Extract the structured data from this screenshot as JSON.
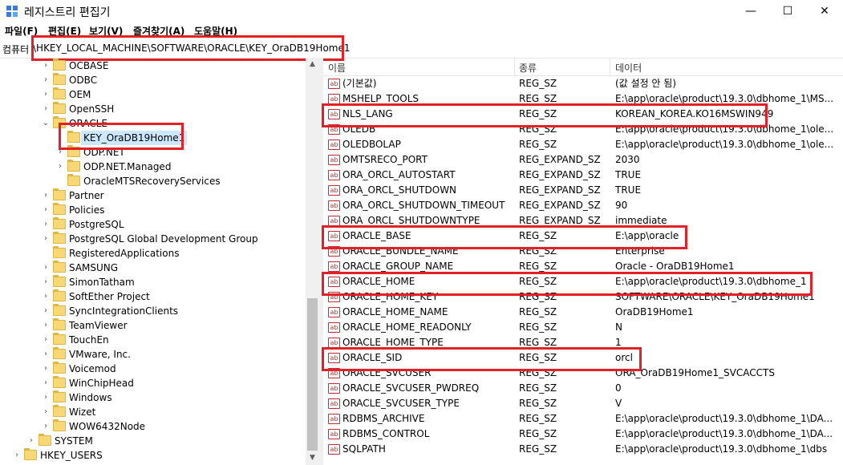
{
  "window": {
    "title": "레지스트리 편집기",
    "minimize_glyph": "—",
    "maximize_glyph": "☐",
    "close_glyph": "✕"
  },
  "menu": [
    "파일(F)",
    "편집(E)",
    "보기(V)",
    "즐겨찾기(A)",
    "도움말(H)"
  ],
  "address": {
    "label": "컴퓨터",
    "path": "\\HKEY_LOCAL_MACHINE\\SOFTWARE\\ORACLE\\KEY_OraDB19Home1"
  },
  "tree": [
    {
      "label": "OCBASE",
      "expander": "›"
    },
    {
      "label": "ODBC",
      "expander": "›"
    },
    {
      "label": "OEM",
      "expander": "›"
    },
    {
      "label": "OpenSSH",
      "expander": "›"
    },
    {
      "label": "ORACLE",
      "expander": "⌄"
    },
    {
      "label": "KEY_OraDB19Home1",
      "expander": ""
    },
    {
      "label": "ODP.NET",
      "expander": "›"
    },
    {
      "label": "ODP.NET.Managed",
      "expander": "›"
    },
    {
      "label": "OracleMTSRecoveryServices",
      "expander": ""
    },
    {
      "label": "Partner",
      "expander": "›"
    },
    {
      "label": "Policies",
      "expander": "›"
    },
    {
      "label": "PostgreSQL",
      "expander": "›"
    },
    {
      "label": "PostgreSQL Global Development Group",
      "expander": "›"
    },
    {
      "label": "RegisteredApplications",
      "expander": ""
    },
    {
      "label": "SAMSUNG",
      "expander": "›"
    },
    {
      "label": "SimonTatham",
      "expander": "›"
    },
    {
      "label": "SoftEther Project",
      "expander": "›"
    },
    {
      "label": "SyncIntegrationClients",
      "expander": "›"
    },
    {
      "label": "TeamViewer",
      "expander": "›"
    },
    {
      "label": "TouchEn",
      "expander": "›"
    },
    {
      "label": "VMware, Inc.",
      "expander": "›"
    },
    {
      "label": "Voicemod",
      "expander": "›"
    },
    {
      "label": "WinChipHead",
      "expander": "›"
    },
    {
      "label": "Windows",
      "expander": "›"
    },
    {
      "label": "Wizet",
      "expander": "›"
    },
    {
      "label": "WOW6432Node",
      "expander": "›"
    },
    {
      "label": "SYSTEM",
      "expander": "›"
    },
    {
      "label": "HKEY_USERS",
      "expander": "›"
    }
  ],
  "columns": {
    "name": "이름",
    "type": "종류",
    "data": "데이터"
  },
  "values": [
    {
      "name": "(기본값)",
      "type": "REG_SZ",
      "data": "(값 설정 안 됨)"
    },
    {
      "name": "MSHELP_TOOLS",
      "type": "REG_SZ",
      "data": "E:\\app\\oracle\\product\\19.3.0\\dbhome_1\\MS..."
    },
    {
      "name": "NLS_LANG",
      "type": "REG_SZ",
      "data": "KOREAN_KOREA.KO16MSWIN949"
    },
    {
      "name": "OLEDB",
      "type": "REG_SZ",
      "data": "E:\\app\\oracle\\product\\19.3.0\\dbhome_1\\ole..."
    },
    {
      "name": "OLEDBOLAP",
      "type": "REG_SZ",
      "data": "E:\\app\\oracle\\product\\19.3.0\\dbhome_1\\ole..."
    },
    {
      "name": "OMTSRECO_PORT",
      "type": "REG_EXPAND_SZ",
      "data": "2030"
    },
    {
      "name": "ORA_ORCL_AUTOSTART",
      "type": "REG_EXPAND_SZ",
      "data": "TRUE"
    },
    {
      "name": "ORA_ORCL_SHUTDOWN",
      "type": "REG_EXPAND_SZ",
      "data": "TRUE"
    },
    {
      "name": "ORA_ORCL_SHUTDOWN_TIMEOUT",
      "type": "REG_EXPAND_SZ",
      "data": "90"
    },
    {
      "name": "ORA_ORCL_SHUTDOWNTYPE",
      "type": "REG_EXPAND_SZ",
      "data": "immediate"
    },
    {
      "name": "ORACLE_BASE",
      "type": "REG_SZ",
      "data": "E:\\app\\oracle"
    },
    {
      "name": "ORACLE_BUNDLE_NAME",
      "type": "REG_SZ",
      "data": "Enterprise"
    },
    {
      "name": "ORACLE_GROUP_NAME",
      "type": "REG_SZ",
      "data": "Oracle - OraDB19Home1"
    },
    {
      "name": "ORACLE_HOME",
      "type": "REG_SZ",
      "data": "E:\\app\\oracle\\product\\19.3.0\\dbhome_1"
    },
    {
      "name": "ORACLE_HOME_KEY",
      "type": "REG_SZ",
      "data": "SOFTWARE\\ORACLE\\KEY_OraDB19Home1"
    },
    {
      "name": "ORACLE_HOME_NAME",
      "type": "REG_SZ",
      "data": "OraDB19Home1"
    },
    {
      "name": "ORACLE_HOME_READONLY",
      "type": "REG_SZ",
      "data": "N"
    },
    {
      "name": "ORACLE_HOME_TYPE",
      "type": "REG_SZ",
      "data": "1"
    },
    {
      "name": "ORACLE_SID",
      "type": "REG_SZ",
      "data": "orcl"
    },
    {
      "name": "ORACLE_SVCUSER",
      "type": "REG_SZ",
      "data": "ORA_OraDB19Home1_SVCACCTS"
    },
    {
      "name": "ORACLE_SVCUSER_PWDREQ",
      "type": "REG_SZ",
      "data": "0"
    },
    {
      "name": "ORACLE_SVCUSER_TYPE",
      "type": "REG_SZ",
      "data": "V"
    },
    {
      "name": "RDBMS_ARCHIVE",
      "type": "REG_SZ",
      "data": "E:\\app\\oracle\\product\\19.3.0\\dbhome_1\\DA..."
    },
    {
      "name": "RDBMS_CONTROL",
      "type": "REG_SZ",
      "data": "E:\\app\\oracle\\product\\19.3.0\\dbhome_1\\DA..."
    },
    {
      "name": "SQLPATH",
      "type": "REG_SZ",
      "data": "E:\\app\\oracle\\product\\19.3.0\\dbhome_1\\dbs"
    }
  ],
  "value_icon_text": "ab",
  "scroll_up_glyph": "▲",
  "scroll_down_glyph": "▼",
  "colors": {
    "highlight": "#e32027",
    "selection": "#cce8ff",
    "folder": "#f8d775"
  }
}
